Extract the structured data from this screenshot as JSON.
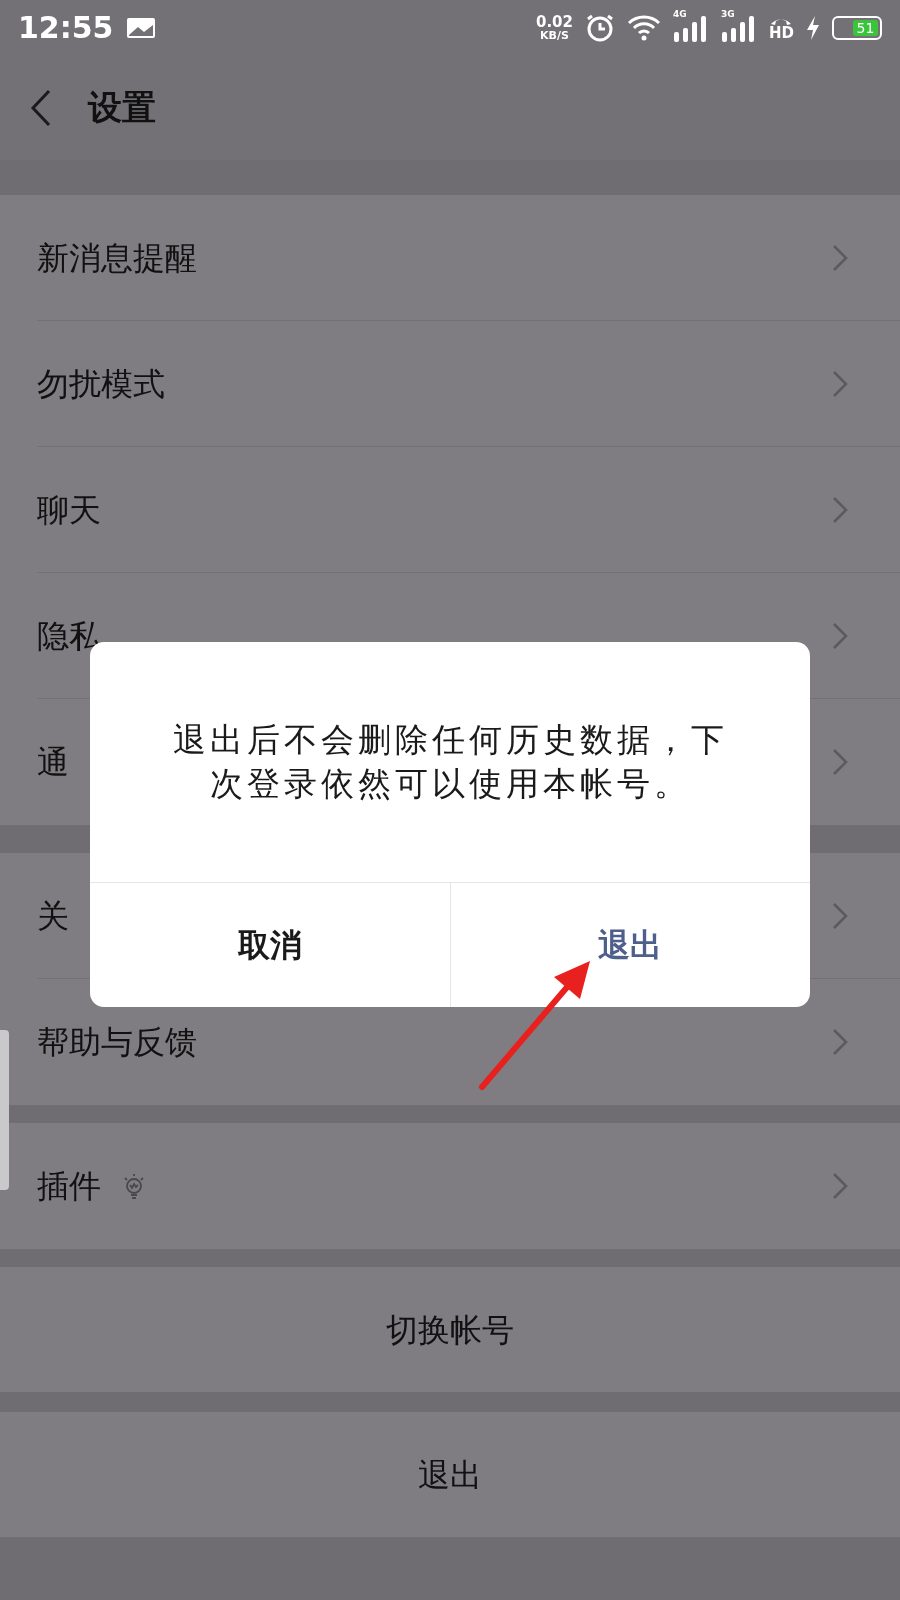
{
  "status_bar": {
    "time": "12:55",
    "speed": "0.02",
    "speed_unit": "KB/S",
    "network_1": "4G",
    "network_2": "3G",
    "call_badge": "HD",
    "battery": "51"
  },
  "header": {
    "title": "设置"
  },
  "groups": [
    {
      "items": [
        {
          "label": "新消息提醒",
          "kind": "plain"
        },
        {
          "label": "勿扰模式",
          "kind": "plain"
        },
        {
          "label": "聊天",
          "kind": "plain"
        },
        {
          "label": "隐私",
          "kind": "plain"
        },
        {
          "label": "通",
          "kind": "plain"
        }
      ]
    },
    {
      "items": [
        {
          "label": "关",
          "kind": "plain"
        },
        {
          "label": "帮助与反馈",
          "kind": "plain"
        }
      ]
    },
    {
      "items": [
        {
          "label": "插件",
          "kind": "bulb"
        }
      ]
    }
  ],
  "actions": [
    {
      "label": "切换帐号"
    },
    {
      "label": "退出"
    }
  ],
  "dialog": {
    "message": "退出后不会删除任何历史数据，下次登录依然可以使用本帐号。",
    "buttons": [
      {
        "label": "取消",
        "kind": "cancel"
      },
      {
        "label": "退出",
        "kind": "confirm"
      }
    ]
  }
}
